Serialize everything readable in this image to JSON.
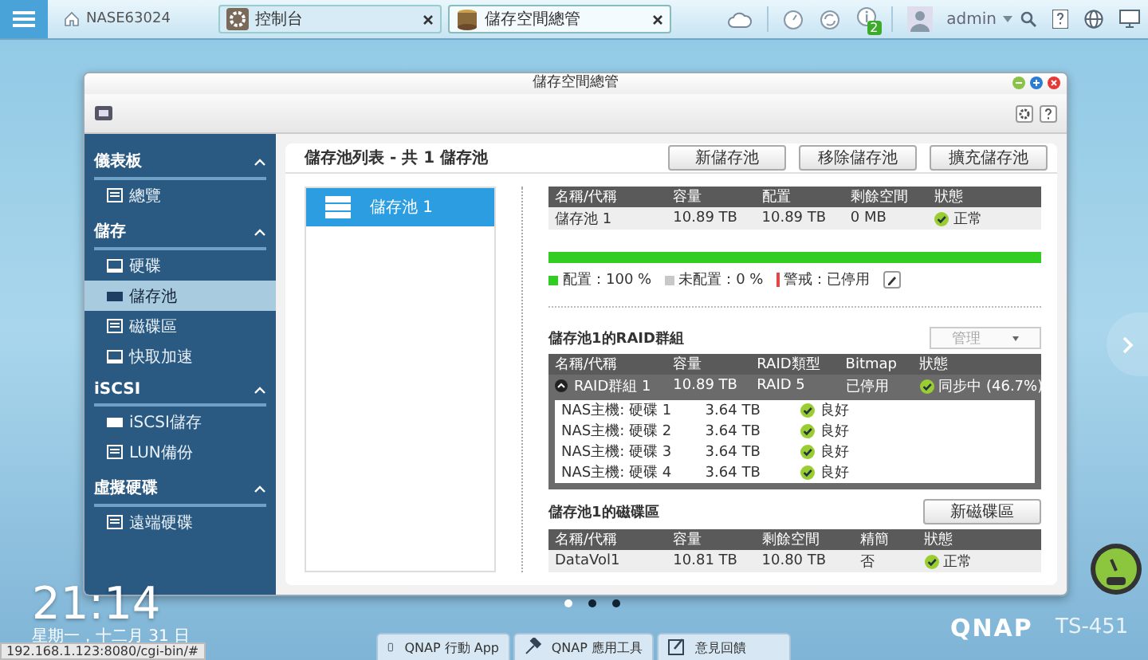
{
  "top_bar": {
    "host": "NASE63024",
    "tabs": [
      {
        "label": "控制台",
        "selected": false
      },
      {
        "label": "儲存空間總管",
        "selected": true
      }
    ],
    "notification_count": "2",
    "user": "admin"
  },
  "window": {
    "title": "儲存空間總管"
  },
  "sidebar": {
    "sections": [
      {
        "title": "儀表板",
        "expanded": true,
        "items": [
          {
            "label": "總覽",
            "selected": false
          }
        ]
      },
      {
        "title": "儲存",
        "expanded": true,
        "items": [
          {
            "label": "硬碟",
            "selected": false
          },
          {
            "label": "儲存池",
            "selected": true
          },
          {
            "label": "磁碟區",
            "selected": false
          },
          {
            "label": "快取加速",
            "selected": false
          }
        ]
      },
      {
        "title": "iSCSI",
        "expanded": true,
        "items": [
          {
            "label": "iSCSI儲存",
            "selected": false
          },
          {
            "label": "LUN備份",
            "selected": false
          }
        ]
      },
      {
        "title": "虛擬硬碟",
        "expanded": true,
        "items": [
          {
            "label": "遠端硬碟",
            "selected": false
          }
        ]
      }
    ]
  },
  "pool_list": {
    "title": "儲存池列表 - 共 1 儲存池",
    "pools": [
      {
        "label": "儲存池 1",
        "selected": true
      }
    ]
  },
  "buttons": [
    "新儲存池",
    "移除儲存池",
    "擴充儲存池"
  ],
  "pool_table": {
    "columns": [
      "名稱/代稱",
      "容量",
      "配置",
      "剩餘空間",
      "狀態"
    ],
    "rows": [
      {
        "cells": [
          "儲存池 1",
          "10.89 TB",
          "10.89 TB",
          "0 MB"
        ],
        "status": "正常"
      }
    ]
  },
  "allocation": {
    "level": 1,
    "legend": [
      {
        "label": "配置：100 %",
        "color": "#33cc22"
      },
      {
        "label": "未配置：0 %",
        "color": "#c8c8c8"
      },
      {
        "label": "警戒：已停用",
        "color": "#e04848"
      }
    ]
  },
  "raid": {
    "title": "儲存池1的RAID群組",
    "manage_button": {
      "label": "管理",
      "disabled": true
    },
    "columns": [
      "名稱/代稱",
      "容量",
      "RAID類型",
      "Bitmap",
      "狀態"
    ],
    "groups": [
      {
        "cells": [
          "RAID群組 1",
          "10.89 TB",
          "RAID 5",
          "已停用"
        ],
        "status": "同步中 (46.7%)",
        "expanded": true,
        "disks": [
          {
            "name": "NAS主機: 硬碟 1",
            "capacity": "3.64 TB",
            "status": "良好"
          },
          {
            "name": "NAS主機: 硬碟 2",
            "capacity": "3.64 TB",
            "status": "良好"
          },
          {
            "name": "NAS主機: 硬碟 3",
            "capacity": "3.64 TB",
            "status": "良好"
          },
          {
            "name": "NAS主機: 硬碟 4",
            "capacity": "3.64 TB",
            "status": "良好"
          }
        ]
      }
    ]
  },
  "volumes": {
    "title": "儲存池1的磁碟區",
    "button": "新磁碟區",
    "columns": [
      "名稱/代稱",
      "容量",
      "剩餘空間",
      "精簡",
      "狀態"
    ],
    "rows": [
      {
        "cells": [
          "DataVol1",
          "10.81 TB",
          "10.80 TB",
          "否"
        ],
        "status": "正常"
      }
    ]
  },
  "desktop": {
    "clock": "21:14",
    "date": "星期一，十二月 31 日",
    "pages": [
      {
        "selected": true
      },
      {
        "selected": false
      },
      {
        "selected": false
      }
    ],
    "dock": [
      "QNAP 行動 App",
      "QNAP 應用工具",
      "意見回饋"
    ],
    "brand": "QNAP",
    "model": "TS-451"
  },
  "status_bar": {
    "url": "192.168.1.123:8080/cgi-bin/#"
  }
}
